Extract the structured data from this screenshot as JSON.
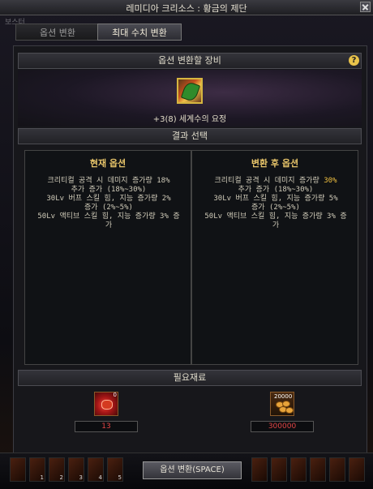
{
  "window": {
    "title": "레미디아 크리소스 : 황금의 제단",
    "behind_label": "보스터"
  },
  "tabs": [
    {
      "label": "옵션 변환",
      "active": false
    },
    {
      "label": "최대 수치 변환",
      "active": true
    }
  ],
  "sections": {
    "equipment_header": "옵션 변환할 장비",
    "result_header": "결과 선택",
    "materials_header": "필요재료"
  },
  "item": {
    "name": "+3(8) 세계수의 요정",
    "icon": "fairy-leaf-icon"
  },
  "current_option": {
    "title": "현재 옵션",
    "lines": [
      "크리티컬 공격 시 데미지 증가량 18%",
      "추가 증가 (18%~30%)",
      "30Lv 버프 스킬 힘, 지능 증가량 2%",
      "증가 (2%~5%)",
      "50Lv 액티브 스킬 힘, 지능 증가량 3% 증",
      "가"
    ]
  },
  "new_option": {
    "title": "변환 후 옵션",
    "line1_prefix": "크리티컬 공격 시 데미지 증가량 ",
    "line1_value": "30%",
    "lines": [
      "추가 증가 (18%~30%)",
      "30Lv 버프 스킬 힘, 지능 증가량 5%",
      "증가 (2%~5%)",
      "50Lv 액티브 스킬 힘, 지능 증가량 3% 증",
      "가"
    ]
  },
  "materials": [
    {
      "icon": "red-crystal-icon",
      "badge": "0",
      "quantity": "13"
    },
    {
      "icon": "gold-coins-icon",
      "badge": "20000",
      "quantity": "300000"
    }
  ],
  "submit_label": "옵션 변환(SPACE)",
  "hotbar_numbers": [
    "1",
    "2",
    "3",
    "4",
    "5"
  ],
  "colors": {
    "accent_gold": "#e8c56a",
    "highlight": "#f0c040",
    "quantity_red": "#e24545"
  }
}
